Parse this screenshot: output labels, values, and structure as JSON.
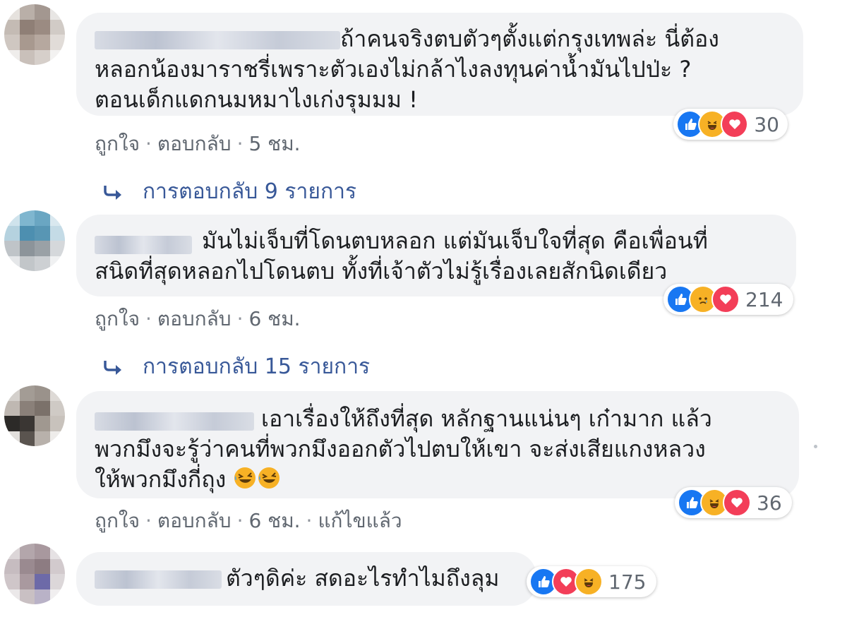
{
  "comments": [
    {
      "text_lines": [
        "ถ้าคนจริงตบตัวๆตั้งแต่กรุงเทพล่ะ นี่ต้อง",
        "หลอกน้องมาราชรี่เพราะตัวเองไม่กล้าไงลงทุนค่าน้ำมันไปป่ะ ?",
        "ตอนเด็กแดกนมหมาไงเก่งรุมมม !"
      ],
      "reactions": [
        "like",
        "haha",
        "love"
      ],
      "reaction_count": "30",
      "like_label": "ถูกใจ",
      "reply_label": "ตอบกลับ",
      "time": "5 ชม.",
      "replies_label": "การตอบกลับ 9 รายการ"
    },
    {
      "text_lines": [
        "มันไม่เจ็บที่โดนตบหลอก แต่มันเจ็บใจที่สุด คือเพื่อนที่",
        "สนิดที่สุดหลอกไปโดนตบ ทั้งที่เจ้าตัวไม่รู้เรื่องเลยสักนิดเดียว"
      ],
      "reactions": [
        "like",
        "sad",
        "love"
      ],
      "reaction_count": "214",
      "like_label": "ถูกใจ",
      "reply_label": "ตอบกลับ",
      "time": "6 ชม.",
      "replies_label": "การตอบกลับ 15 รายการ"
    },
    {
      "text_lines": [
        "เอาเรื่องให้ถึงที่สุด หลักฐานแน่นๆ เก๋ามาก แล้ว",
        "พวกมึงจะรู้ว่าคนที่พวกมึงออกตัวไปตบให้เขา จะส่งเสียแกงหลวง",
        "ให้พวกมึงกี่ถุง"
      ],
      "reactions": [
        "like",
        "haha",
        "love"
      ],
      "reaction_count": "36",
      "like_label": "ถูกใจ",
      "reply_label": "ตอบกลับ",
      "time": "6 ชม.",
      "edited_label": "แก้ไขแล้ว"
    },
    {
      "text_lines": [
        "ตัวๆดิค่ะ สดอะไรทำไมถึงลุม"
      ],
      "reactions": [
        "like",
        "love",
        "haha"
      ],
      "reaction_count": "175"
    }
  ],
  "colors": {
    "bubble": "#f2f3f5",
    "link": "#385898",
    "meta": "#606770",
    "like": "#1877f2",
    "love": "#f33e58",
    "haha": "#f7b125"
  }
}
